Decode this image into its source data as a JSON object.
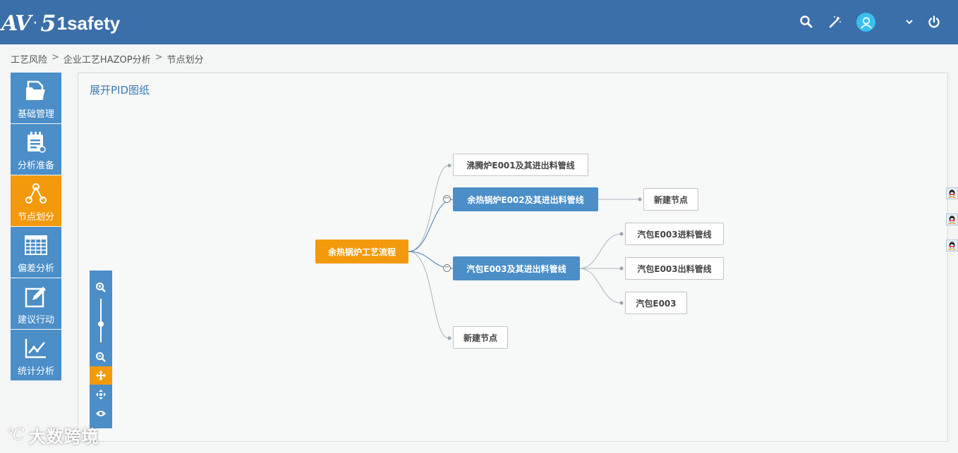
{
  "header": {
    "logo": {
      "mark": "AV",
      "dot": "·",
      "num": "5",
      "text": "1safety"
    }
  },
  "breadcrumb": [
    "工艺风险",
    "企业工艺HAZOP分析",
    "节点划分"
  ],
  "breadcrumb_sep": ">",
  "sidebar": {
    "items": [
      {
        "label": "基础管理",
        "icon": "folder-doc-icon"
      },
      {
        "label": "分析准备",
        "icon": "checklist-icon"
      },
      {
        "label": "节点划分",
        "icon": "node-share-icon",
        "active": true
      },
      {
        "label": "偏差分析",
        "icon": "grid-table-icon"
      },
      {
        "label": "建议行动",
        "icon": "edit-icon"
      },
      {
        "label": "统计分析",
        "icon": "line-chart-icon"
      }
    ]
  },
  "main": {
    "pid_link": "展开PID图纸",
    "mindmap": {
      "root": "余热锅炉工艺流程",
      "children": [
        {
          "label": "沸腾炉E001及其进出料管线"
        },
        {
          "label": "余热锅炉E002及其进出料管线",
          "children": [
            "新建节点"
          ]
        },
        {
          "label": "汽包E003及其进出料管线",
          "children": [
            "汽包E003进料管线",
            "汽包E003出料管线",
            "汽包E003"
          ]
        },
        {
          "label": "新建节点"
        }
      ]
    }
  },
  "watermark": {
    "mark": "℃ ",
    "text": "大数跨境"
  },
  "colors": {
    "header": "#3a6fa9",
    "accent": "#f39a0c",
    "primary": "#4b8ec8"
  }
}
